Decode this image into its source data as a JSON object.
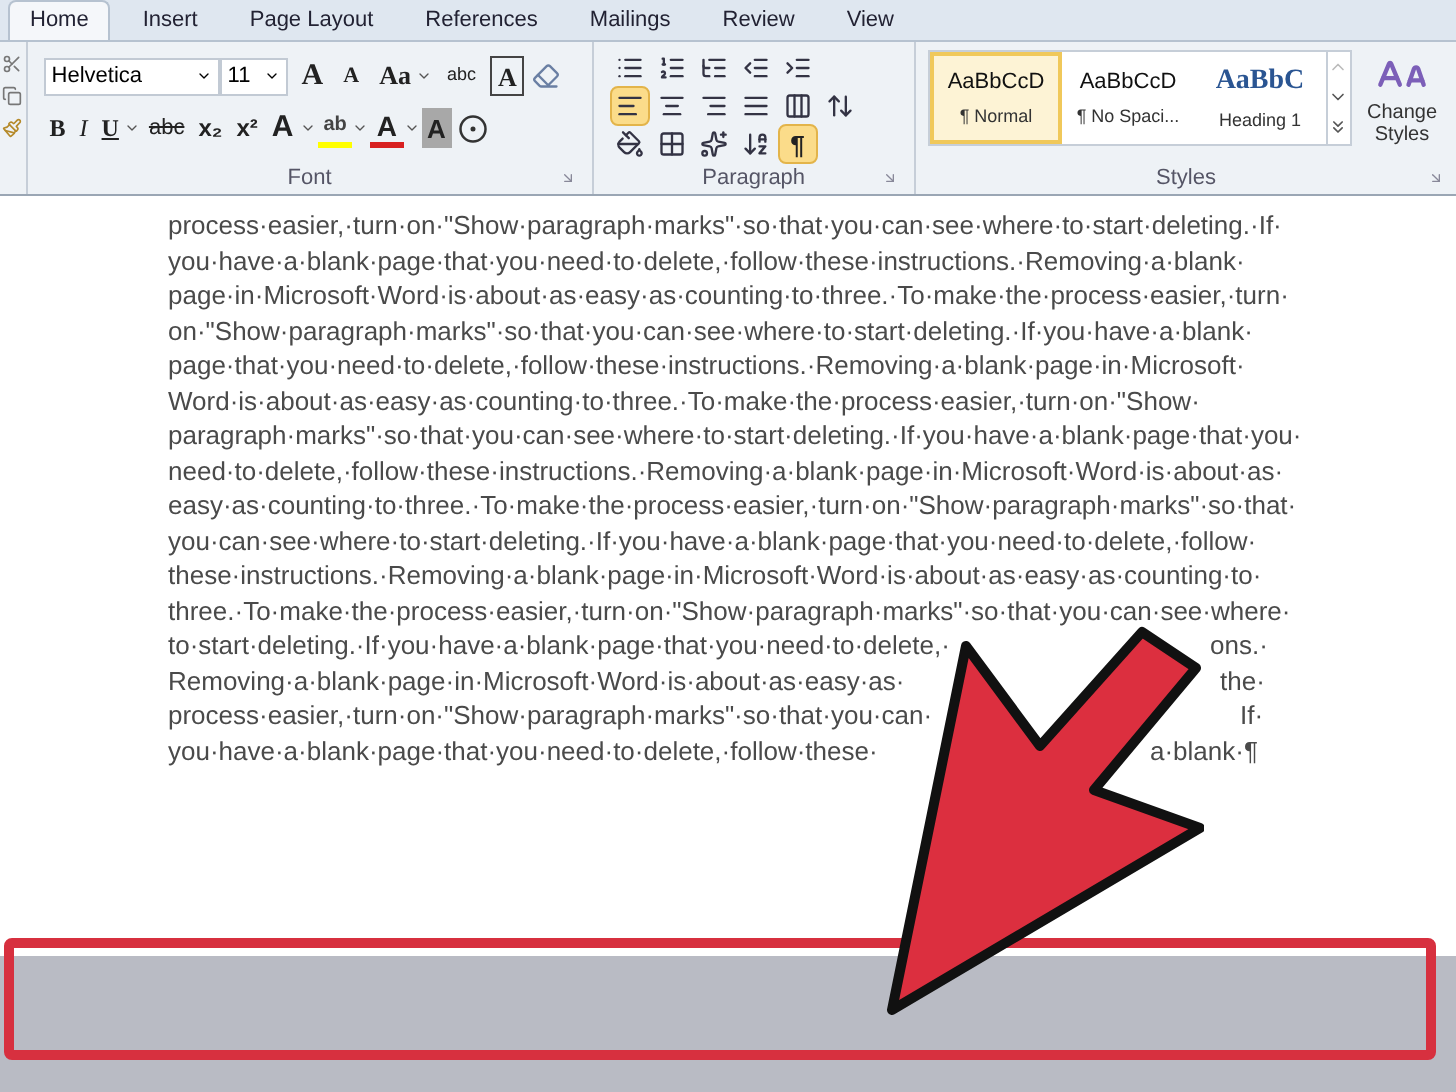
{
  "ribbon_tabs": [
    {
      "label": "Home",
      "selected": true
    },
    {
      "label": "Insert",
      "selected": false
    },
    {
      "label": "Page Layout",
      "selected": false
    },
    {
      "label": "References",
      "selected": false
    },
    {
      "label": "Mailings",
      "selected": false
    },
    {
      "label": "Review",
      "selected": false
    },
    {
      "label": "View",
      "selected": false
    }
  ],
  "font_group": {
    "label": "Font",
    "font_name": "Helvetica",
    "font_size": "11",
    "row1": [
      {
        "label": "A",
        "kind": "grow",
        "dropdown": false
      },
      {
        "label": "A",
        "kind": "shrink",
        "dropdown": false
      },
      {
        "label": "Aa",
        "kind": "plain",
        "dropdown": true
      },
      {
        "label": "abc",
        "kind": "phonetic",
        "dropdown": false
      },
      {
        "label": "A",
        "kind": "boxed",
        "dropdown": false
      }
    ],
    "row2": [
      {
        "label": "B",
        "kind": "bold",
        "dropdown": false
      },
      {
        "label": "I",
        "kind": "italic",
        "dropdown": false
      },
      {
        "label": "U",
        "kind": "underline",
        "dropdown": true
      },
      {
        "label": "abc",
        "kind": "strike",
        "dropdown": false
      },
      {
        "label": "x₂",
        "kind": "sub",
        "dropdown": false
      },
      {
        "label": "x²",
        "kind": "sup",
        "dropdown": false
      },
      {
        "label": "A",
        "kind": "effect",
        "dropdown": true
      },
      {
        "label": "ab",
        "kind": "highlight",
        "dropdown": true
      },
      {
        "label": "A",
        "kind": "color",
        "dropdown": true
      },
      {
        "label": "A",
        "kind": "shading",
        "dropdown": false
      }
    ]
  },
  "paragraph_group": {
    "label": "Paragraph",
    "rows": [
      [
        {
          "kind": "bullets",
          "selected": false
        },
        {
          "kind": "numbering",
          "selected": false
        },
        {
          "kind": "multilevel",
          "selected": false
        },
        {
          "kind": "outdent",
          "selected": false
        },
        {
          "kind": "indent",
          "selected": false
        }
      ],
      [
        {
          "kind": "align-left",
          "selected": true
        },
        {
          "kind": "align-center",
          "selected": false
        },
        {
          "kind": "align-right",
          "selected": false
        },
        {
          "kind": "justify",
          "selected": false
        },
        {
          "kind": "distribute",
          "selected": false
        },
        {
          "kind": "spacing",
          "selected": false
        }
      ],
      [
        {
          "kind": "shading",
          "selected": false
        },
        {
          "kind": "borders",
          "selected": false
        },
        {
          "kind": "asian",
          "selected": false
        },
        {
          "kind": "sort",
          "selected": false
        },
        {
          "kind": "marks",
          "label": "¶",
          "selected": true
        }
      ]
    ]
  },
  "styles_group": {
    "label": "Styles",
    "styles": [
      {
        "preview": "AaBbCcD",
        "name": "¶ Normal",
        "kind": "body",
        "selected": true
      },
      {
        "preview": "AaBbCcD",
        "name": "¶ No Spaci...",
        "kind": "body",
        "selected": false
      },
      {
        "preview": "AaBbC",
        "name": "Heading 1",
        "kind": "heading",
        "selected": false
      }
    ],
    "change_styles": "Change Styles"
  },
  "document": {
    "lines": [
      [
        "process·easier,·turn·on·\"Show·paragraph·marks\"·so·that·you·can·see·where·to·start·deleting.·If·"
      ],
      [
        "you·have·a·blank·page·that·you·need·to·delete,·follow·these·instructions.·Removing·a·blank·"
      ],
      [
        "page·in·Microsoft·Word·is·about·as·easy·as·counting·to·three.·To·make·the·process·easier,·turn·"
      ],
      [
        "on·\"Show·paragraph·marks\"·so·that·you·can·see·where·to·start·deleting.·If·you·have·a·blank·"
      ],
      [
        "page·that·you·need·to·delete,·follow·these·instructions.·Removing·a·blank·page·in·Microsoft·"
      ],
      [
        "Word·is·about·as·easy·as·counting·to·three.·To·make·the·process·easier,·turn·on·\"Show·"
      ],
      [
        "paragraph·marks\"·so·that·you·can·see·where·to·start·deleting.·If·you·have·a·blank·page·that·you·"
      ],
      [
        "need·to·delete,·follow·these·instructions.·Removing·a·blank·page·in·Microsoft·Word·is·about·as·"
      ],
      [
        "easy·as·counting·to·three.·To·make·the·process·easier,·turn·on·\"Show·paragraph·marks\"·so·that·"
      ],
      [
        "you·can·see·where·to·start·deleting.·If·you·have·a·blank·page·that·you·need·to·delete,·follow·"
      ],
      [
        "these·instructions.·Removing·a·blank·page·in·Microsoft·Word·is·about·as·easy·as·counting·to·"
      ],
      [
        "three.·To·make·the·process·easier,·turn·on·\"Show·paragraph·marks\"·so·that·you·can·see·where·"
      ],
      [
        "to·start·deleting.·If·you·have·a·blank·page·that·you·need·to·delete,·",
        "ons.·"
      ],
      [
        "Removing·a·blank·page·in·Microsoft·Word·is·about·as·easy·as·",
        "the·"
      ],
      [
        "process·easier,·turn·on·\"Show·paragraph·marks\"·so·that·you·can·",
        "If·"
      ],
      [
        "you·have·a·blank·page·that·you·need·to·delete,·follow·these·",
        "a·blank·¶"
      ]
    ]
  }
}
